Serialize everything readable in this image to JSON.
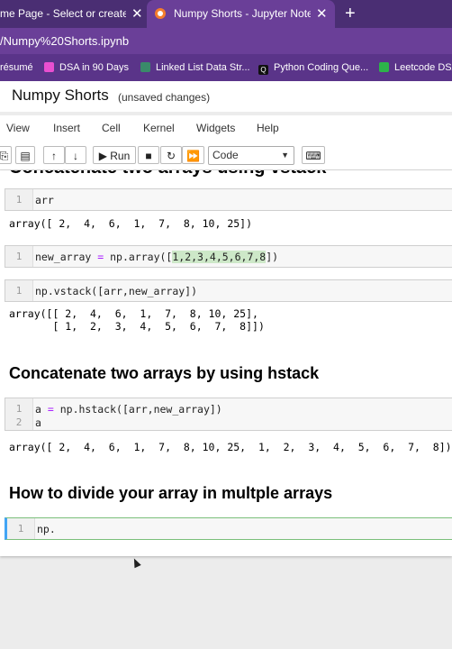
{
  "browser": {
    "tabs": [
      {
        "title": "me Page - Select or create a n"
      },
      {
        "title": "Numpy Shorts - Jupyter Notebook"
      }
    ],
    "url": "Numpy%20Shorts.ipynb",
    "url_prefix": "/",
    "bookmarks": [
      {
        "label": "résumé"
      },
      {
        "label": "DSA in 90 Days"
      },
      {
        "label": "Linked List Data Str..."
      },
      {
        "label": "Python Coding Que..."
      },
      {
        "label": "Leetcode DSA"
      }
    ]
  },
  "notebook": {
    "title": "Numpy Shorts",
    "status": "(unsaved changes)",
    "menu": [
      "View",
      "Insert",
      "Cell",
      "Kernel",
      "Widgets",
      "Help"
    ],
    "toolbar": {
      "run_label": "Run",
      "cell_type": "Code"
    },
    "cut_heading": "Concatenate two arrays using vstack",
    "cells": [
      {
        "n": "1",
        "code": "arr"
      },
      {
        "out": "array([ 2,  4,  6,  1,  7,  8, 10, 25])"
      },
      {
        "n": "1",
        "code_pre": "new_array ",
        "code_op": "=",
        "code_mid": " np.array([",
        "code_hl": "1,2,3,4,5,6,7,8",
        "code_post": "])"
      },
      {
        "n": "1",
        "code": "np.vstack([arr,new_array])"
      },
      {
        "out": "array([[ 2,  4,  6,  1,  7,  8, 10, 25],\n       [ 1,  2,  3,  4,  5,  6,  7,  8]])"
      },
      {
        "heading": "Concatenate two arrays by using hstack"
      },
      {
        "n1": "1",
        "n2": "2",
        "line1_pre": "a ",
        "line1_op": "=",
        "line1_post": " np.hstack([arr,new_array])",
        "line2": "a"
      },
      {
        "out": "array([ 2,  4,  6,  1,  7,  8, 10, 25,  1,  2,  3,  4,  5,  6,  7,  8])"
      },
      {
        "heading": "How to divide your array in multple arrays"
      },
      {
        "n": "1",
        "code": "np."
      }
    ]
  },
  "colors": {
    "tabbar": "#4a2e73",
    "active_tab": "#6a3f98",
    "operator": "#aa22ff"
  }
}
